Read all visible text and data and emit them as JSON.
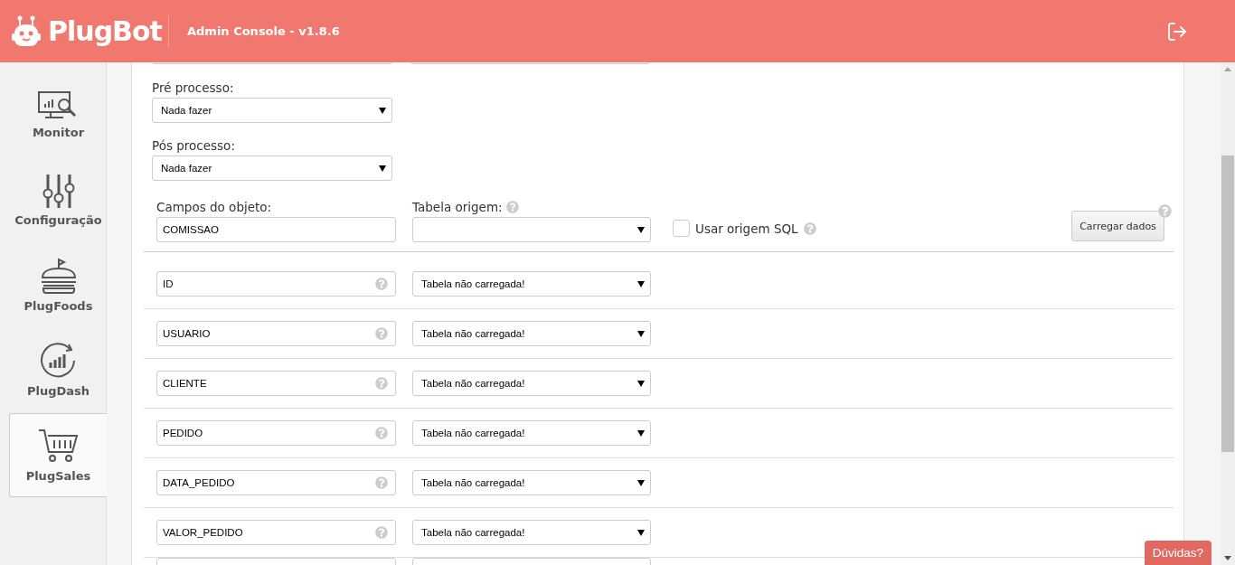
{
  "header": {
    "logo": "PlugBot",
    "title": "Admin Console - v1.8.6"
  },
  "sidebar": {
    "items": [
      {
        "label": "Monitor",
        "kind": "monitor",
        "selected": false
      },
      {
        "label": "Configuração",
        "kind": "sliders",
        "selected": false
      },
      {
        "label": "PlugFoods",
        "kind": "burger",
        "selected": false
      },
      {
        "label": "PlugDash",
        "kind": "dashboard",
        "selected": false
      },
      {
        "label": "PlugSales",
        "kind": "cart",
        "selected": true
      }
    ]
  },
  "form": {
    "pre_processo": {
      "label": "Pré processo:",
      "value": "Nada fazer"
    },
    "pos_processo": {
      "label": "Pós processo:",
      "value": "Nada fazer"
    },
    "campos_do_objeto": {
      "label": "Campos do objeto:",
      "value": "COMISSAO"
    },
    "tabela_origem": {
      "label": "Tabela origem:"
    },
    "usar_origem_sql": {
      "label": "Usar origem SQL",
      "checked": false
    },
    "load_button": "Carregar dados",
    "fields": [
      {
        "name": "ID",
        "mapping": "Tabela não carregada!"
      },
      {
        "name": "USUARIO",
        "mapping": "Tabela não carregada!"
      },
      {
        "name": "CLIENTE",
        "mapping": "Tabela não carregada!"
      },
      {
        "name": "PEDIDO",
        "mapping": "Tabela não carregada!"
      },
      {
        "name": "DATA_PEDIDO",
        "mapping": "Tabela não carregada!"
      },
      {
        "name": "VALOR_PEDIDO",
        "mapping": "Tabela não carregada!"
      }
    ]
  },
  "help_button": "Dúvidas?"
}
